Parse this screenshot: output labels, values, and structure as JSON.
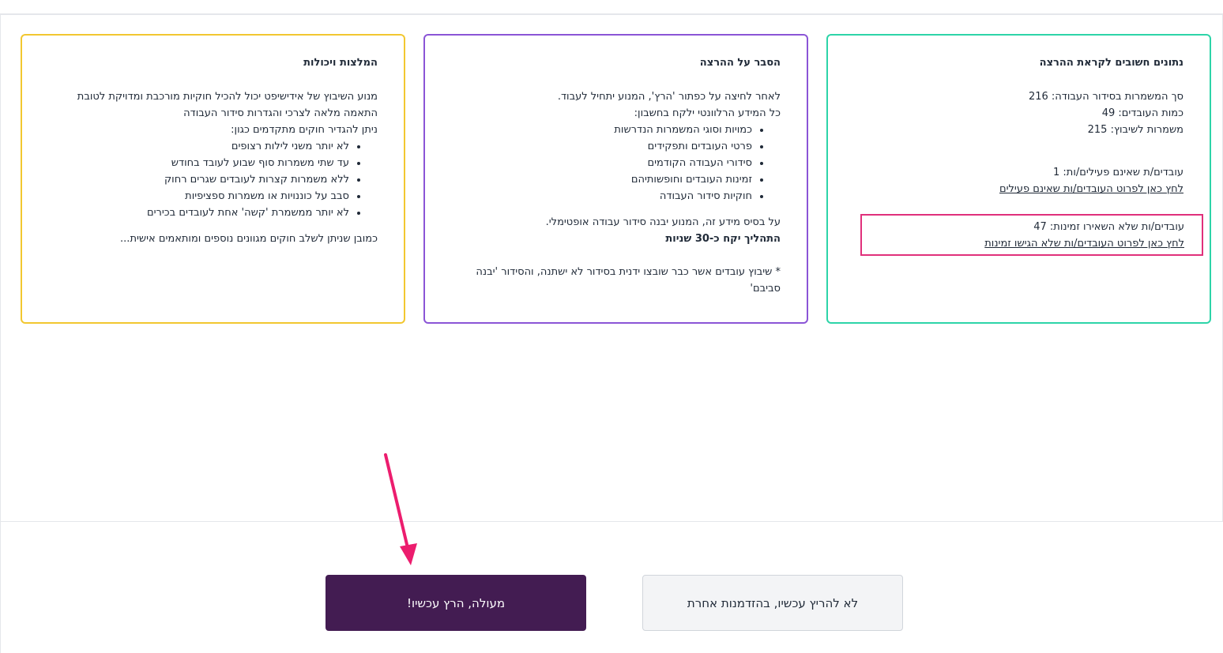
{
  "stats_card": {
    "title": "נתונים חשובים לקראת ההרצה",
    "total_shifts": "סך המשמרות בסידור העבודה: 216",
    "employee_count": "כמות העובדים: 49",
    "shifts_to_assign": "משמרות לשיבוץ: 215",
    "inactive_employees": "עובדים/ת שאינם פעילים/ות: 1",
    "inactive_link": "לחץ כאן לפרוט העובדים/ות שאינם פעילים",
    "no_availability": "עובדים/ות שלא השאירו זמינות: 47",
    "no_availability_link": "לחץ כאן לפרוט העובדים/ות שלא הגישו זמינות"
  },
  "explain_card": {
    "title": "הסבר על ההרצה",
    "intro_1": "לאחר לחיצה על כפתור 'הרץ', המנוע יתחיל לעבוד.",
    "intro_2": "כל המידע הרלוונטי ילקח בחשבון:",
    "bullets": [
      "כמויות וסוגי המשמרות הנדרשות",
      "פרטי העובדים ותפקידים",
      "סידורי העבודה הקודמים",
      "זמינות העובדים וחופשותיהם",
      "חוקיות סידור העבודה"
    ],
    "outro": "על בסיס מידע זה, המנוע יבנה סידור עבודה אופטימלי.",
    "duration": "התהליך יקח כ-30 שניות",
    "note": "* שיבוץ עובדים אשר כבר שובצו ידנית בסידור לא ישתנה, והסידור 'יבנה סביבם'"
  },
  "tips_card": {
    "title": "המלצות ויכולות",
    "intro": "מנוע השיבוץ של אידישיפט יכול להכיל חוקיות מורכבת ומדויקת לטובת התאמה מלאה לצרכי והגדרות סידור העבודה",
    "intro_2": "ניתן להגדיר חוקים מתקדמים כגון:",
    "bullets": [
      "לא יותר משני לילות רצופים",
      "עד שתי משמרות סוף שבוע לעובד בחודש",
      "ללא משמרות קצרות לעובדים שגרים רחוק",
      "סבב על כוננויות או משמרות ספציפיות",
      "לא יותר ממשמרת 'קשה' אחת לעובדים בכירים"
    ],
    "outro": "כמובן שניתן לשלב חוקים מגוונים נוספים ומותאמים אישית..."
  },
  "buttons": {
    "run_label": "מעולה, הרץ עכשיו!",
    "later_label": "לא להריץ עכשיו, בהזדמנות אחרת"
  },
  "colors": {
    "stats_border": "#2dd4a8",
    "explain_border": "#8b55d6",
    "tips_border": "#f2c730",
    "highlight": "#e0307b",
    "run_button": "#431c52"
  }
}
